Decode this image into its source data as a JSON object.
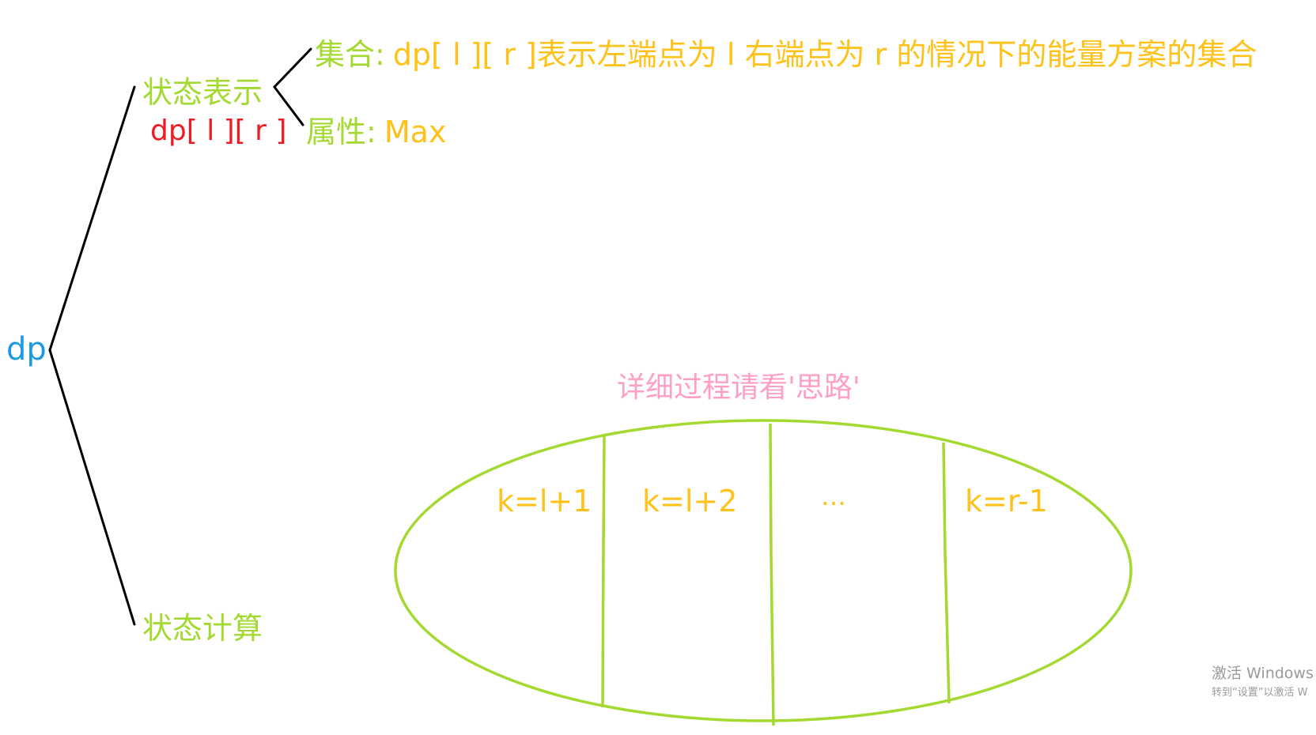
{
  "root": {
    "label": "dp"
  },
  "state_repr": {
    "label": "状态表示",
    "sub_label": "dp[ l ][ r ]",
    "set": {
      "prefix": "集合:",
      "text": "dp[ l ][ r ]表示左端点为 l 右端点为 r 的情况下的能量方案的集合"
    },
    "attr": {
      "prefix": "属性:",
      "text": "Max"
    }
  },
  "state_calc": {
    "label": "状态计算"
  },
  "note": "详细过程请看'思路'",
  "partitions": [
    "k=l+1",
    "k=l+2",
    "…",
    "k=r-1"
  ],
  "watermark": {
    "line1": "激活 Windows",
    "line2": "转到“设置”以激活 W"
  },
  "colors": {
    "green": "#a3d930",
    "gold": "#ffc21a",
    "red": "#ed1c24",
    "blue": "#1e9be0",
    "pink": "#ff9fc5",
    "black": "#000000"
  }
}
